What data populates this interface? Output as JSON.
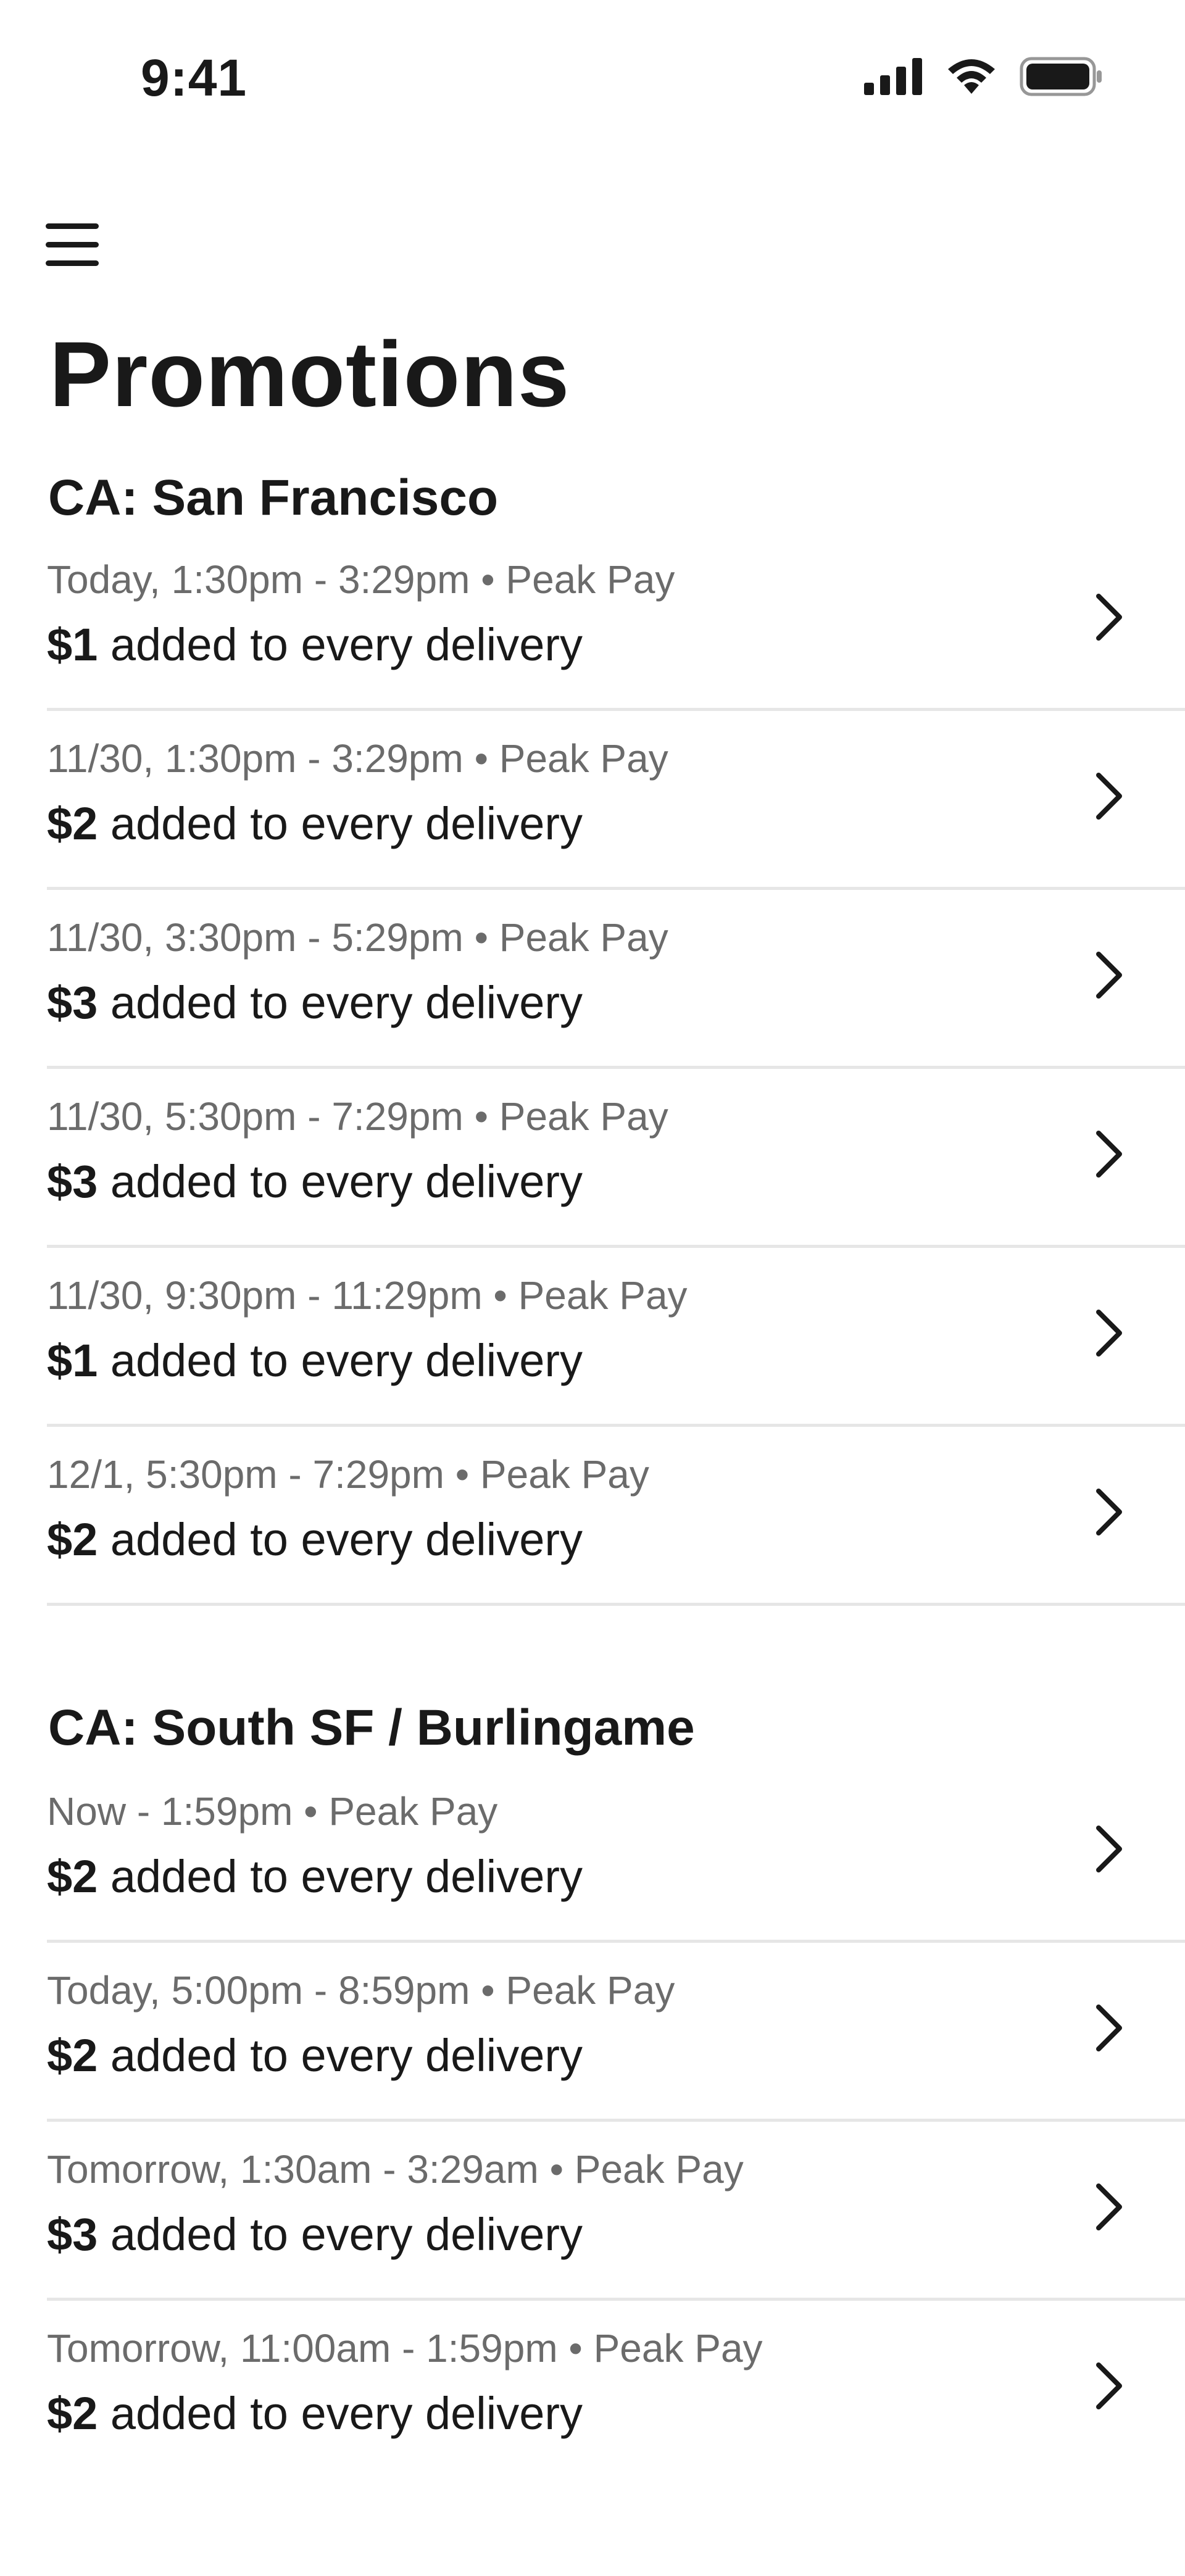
{
  "status_bar": {
    "time": "9:41",
    "icons": [
      "cellular-signal-icon",
      "wifi-icon",
      "battery-icon"
    ]
  },
  "header": {
    "menu_icon": "hamburger-menu-icon",
    "title": "Promotions"
  },
  "sections": [
    {
      "title": "CA: San Francisco",
      "items": [
        {
          "time": "Today, 1:30pm - 3:29pm",
          "type": "Peak Pay",
          "amount": "$1",
          "text": "added to every delivery"
        },
        {
          "time": "11/30, 1:30pm - 3:29pm",
          "type": "Peak Pay",
          "amount": "$2",
          "text": "added to every delivery"
        },
        {
          "time": "11/30, 3:30pm - 5:29pm",
          "type": "Peak Pay",
          "amount": "$3",
          "text": "added to every delivery"
        },
        {
          "time": "11/30, 5:30pm - 7:29pm",
          "type": "Peak Pay",
          "amount": "$3",
          "text": "added to every delivery"
        },
        {
          "time": "11/30, 9:30pm - 11:29pm",
          "type": "Peak Pay",
          "amount": "$1",
          "text": "added to every delivery"
        },
        {
          "time": "12/1, 5:30pm - 7:29pm",
          "type": "Peak Pay",
          "amount": "$2",
          "text": "added to every delivery"
        }
      ]
    },
    {
      "title": "CA: South SF / Burlingame",
      "items": [
        {
          "time": "Now - 1:59pm",
          "type": "Peak Pay",
          "amount": "$2",
          "text": "added to every delivery"
        },
        {
          "time": "Today, 5:00pm - 8:59pm",
          "type": "Peak Pay",
          "amount": "$2",
          "text": "added to every delivery"
        },
        {
          "time": "Tomorrow, 1:30am - 3:29am",
          "type": "Peak Pay",
          "amount": "$3",
          "text": "added to every delivery"
        },
        {
          "time": "Tomorrow, 11:00am - 1:59pm",
          "type": "Peak Pay",
          "amount": "$2",
          "text": "added to every delivery"
        }
      ]
    }
  ],
  "separator": "•",
  "colors": {
    "text": "#191919",
    "secondary": "#6b6b6b",
    "divider": "#e6e6e6",
    "background": "#ffffff"
  }
}
